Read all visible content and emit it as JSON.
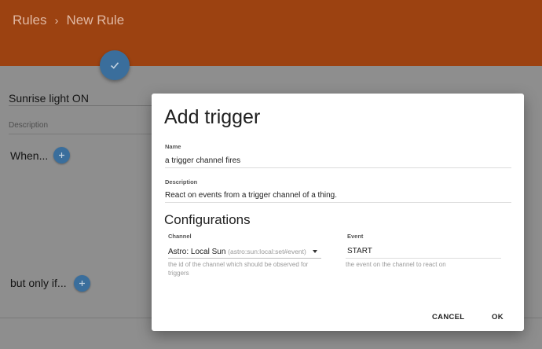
{
  "header": {
    "breadcrumb_root": "Rules",
    "breadcrumb_separator": "›",
    "breadcrumb_current": "New Rule",
    "background_color": "#9c4211"
  },
  "save_fab": {
    "icon": "check-icon",
    "color": "#3a6e9c"
  },
  "rule": {
    "name_value": "Sunrise light ON",
    "description_label": "Description",
    "when_label": "When...",
    "only_if_label": "but only if...",
    "add_icon": "plus-icon"
  },
  "dialog": {
    "title": "Add trigger",
    "name_label": "Name",
    "name_value": "a trigger channel fires",
    "description_label": "Description",
    "description_value": "React on events from a trigger channel of a thing.",
    "configurations_title": "Configurations",
    "channel": {
      "label": "Channel",
      "value": "Astro: Local Sun",
      "value_detail": "(astro:sun:local:set#event)",
      "hint_line1": "the id of the channel which should be observed for",
      "hint_line2": "triggers"
    },
    "event": {
      "label": "Event",
      "value": "START",
      "hint": "the event on the channel to react on"
    },
    "cancel_label": "CANCEL",
    "ok_label": "OK"
  }
}
